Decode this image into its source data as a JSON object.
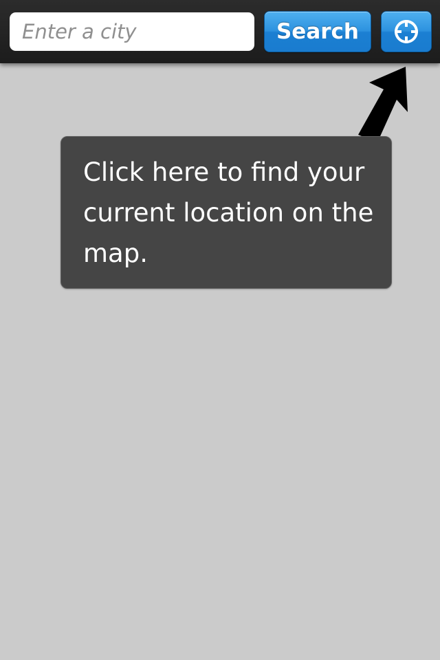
{
  "search": {
    "placeholder": "Enter a city",
    "value": "",
    "button_label": "Search"
  },
  "locate": {
    "icon": "crosshair-icon"
  },
  "tooltip": {
    "text": "Click here to find your current location on the map."
  },
  "colors": {
    "toolbar": "#222222",
    "button_blue": "#2d92df",
    "map_background": "#cbcbcb",
    "tooltip_background": "#454545"
  }
}
